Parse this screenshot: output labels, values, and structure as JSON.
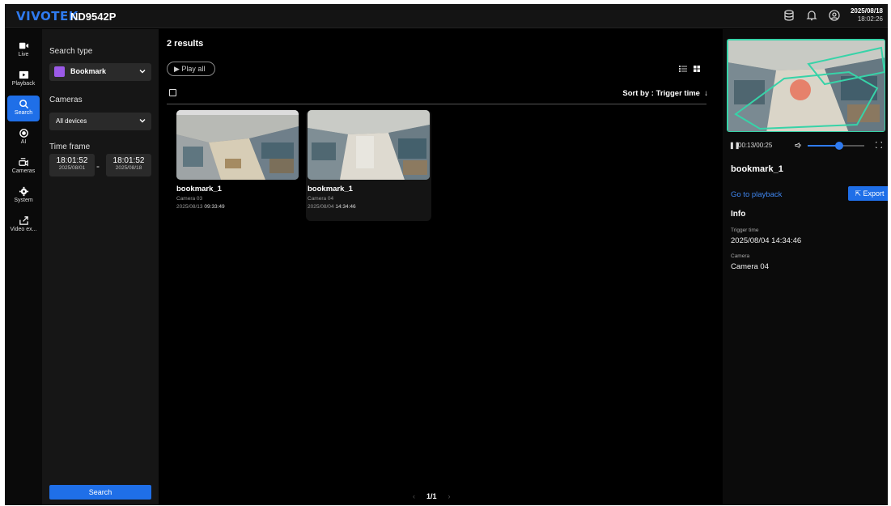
{
  "header": {
    "brand": "VIVOTEK",
    "model": "ND9542P",
    "date": "2025/08/18",
    "time": "18:02:26"
  },
  "nav": {
    "items": [
      {
        "label": "Live",
        "icon": "live-camera-icon"
      },
      {
        "label": "Playback",
        "icon": "playback-icon"
      },
      {
        "label": "Search",
        "icon": "search-icon",
        "active": true
      },
      {
        "label": "AI",
        "icon": "ai-icon"
      },
      {
        "label": "Cameras",
        "icon": "cameras-icon"
      },
      {
        "label": "System",
        "icon": "gear-icon"
      },
      {
        "label": "Video ex...",
        "icon": "video-export-icon"
      }
    ]
  },
  "search_panel": {
    "search_type_label": "Search type",
    "search_type_value": "Bookmark",
    "cameras_label": "Cameras",
    "cameras_value": "All devices",
    "time_frame_label": "Time frame",
    "start_time": "18:01:52",
    "start_date": "2025/08/01",
    "separator": "-",
    "end_time": "18:01:52",
    "end_date": "2025/08/18",
    "search_button": "Search"
  },
  "results": {
    "count_text": "2 results",
    "play_all": "Play all",
    "sort_text": "Sort by : Trigger time",
    "items": [
      {
        "name": "bookmark_1",
        "camera": "Camera 03",
        "date": "2025/08/13",
        "time": "09:33:49"
      },
      {
        "name": "bookmark_1",
        "camera": "Camera 04",
        "date": "2025/08/04",
        "time": "14:34:46"
      }
    ],
    "page": "1/1"
  },
  "detail": {
    "playback_time": "00:13/00:25",
    "volume_level": 0.55,
    "title": "bookmark_1",
    "goto_playback": "Go to playback",
    "export": "Export",
    "info_heading": "Info",
    "trigger_time_label": "Trigger time",
    "trigger_time_value": "2025/08/04 14:34:46",
    "camera_label": "Camera",
    "camera_value": "Camera 04"
  },
  "colors": {
    "accent": "#1f6fe8",
    "bookmark": "#9b5ae8",
    "overlay": "#37d3a8"
  }
}
